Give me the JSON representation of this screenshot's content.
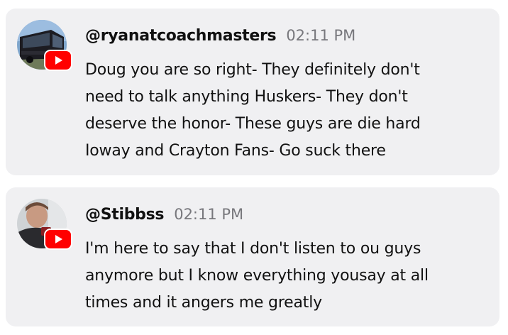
{
  "comments": [
    {
      "username": "@ryanatcoachmasters",
      "time": "02:11 PM",
      "avatar": "tour-bus-photo",
      "platform_icon": "youtube-icon",
      "lines": [
        "Doug you are so right- They definitely don't",
        "need to talk anything Huskers- They don't",
        "deserve the honor- These guys are die hard",
        "Ioway and Crayton Fans- Go suck there"
      ]
    },
    {
      "username": "@Stibbss",
      "time": "02:11 PM",
      "avatar": "person-photo",
      "platform_icon": "youtube-icon",
      "lines": [
        "I'm here to say that I don't listen to ou guys",
        "anymore but I know everything yousay at all",
        "times and it angers me greatly"
      ]
    }
  ],
  "colors": {
    "card_background": "#f0f0f2",
    "timestamp": "#77777c",
    "youtube_red": "#ff0000"
  }
}
